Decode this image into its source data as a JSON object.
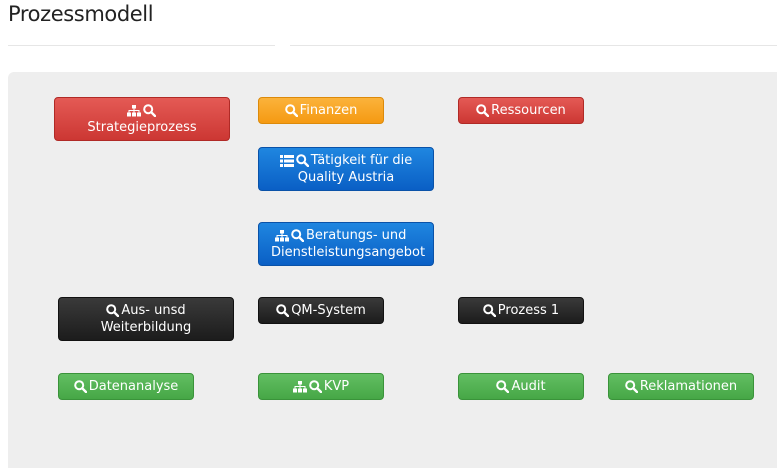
{
  "page": {
    "title": "Prozessmodell"
  },
  "buttons": {
    "strategieprozess": {
      "label": "Strategieprozess",
      "icons": [
        "sitemap-icon",
        "search-icon"
      ],
      "color": "#d9423e"
    },
    "finanzen": {
      "label": "Finanzen",
      "icons": [
        "search-icon"
      ],
      "color": "#f6a625"
    },
    "ressourcen": {
      "label": "Ressourcen",
      "icons": [
        "search-icon"
      ],
      "color": "#d9423e"
    },
    "taetigkeit": {
      "line1": "Tätigkeit für die",
      "line2": "Quality Austria",
      "icons": [
        "list-icon",
        "search-icon"
      ],
      "color": "#0d6fd6"
    },
    "beratung": {
      "line1": "Beratungs- und",
      "line2": "Dienstleistungsangebot",
      "icons": [
        "sitemap-icon",
        "search-icon"
      ],
      "color": "#0d6fd6"
    },
    "ausbildung": {
      "line1": "Aus- unsd",
      "line2": "Weiterbildung",
      "icons": [
        "search-icon"
      ],
      "color": "#2a2a2a"
    },
    "qm_system": {
      "label": "QM-System",
      "icons": [
        "search-icon"
      ],
      "color": "#2a2a2a"
    },
    "prozess1": {
      "label": "Prozess 1",
      "icons": [
        "search-icon"
      ],
      "color": "#2a2a2a"
    },
    "datenanalyse": {
      "label": "Datenanalyse",
      "icons": [
        "search-icon"
      ],
      "color": "#52b152"
    },
    "kvp": {
      "label": "KVP",
      "icons": [
        "sitemap-icon",
        "search-icon"
      ],
      "color": "#52b152"
    },
    "audit": {
      "label": "Audit",
      "icons": [
        "search-icon"
      ],
      "color": "#52b152"
    },
    "reklamationen": {
      "label": "Reklamationen",
      "icons": [
        "search-icon"
      ],
      "color": "#52b152"
    }
  }
}
